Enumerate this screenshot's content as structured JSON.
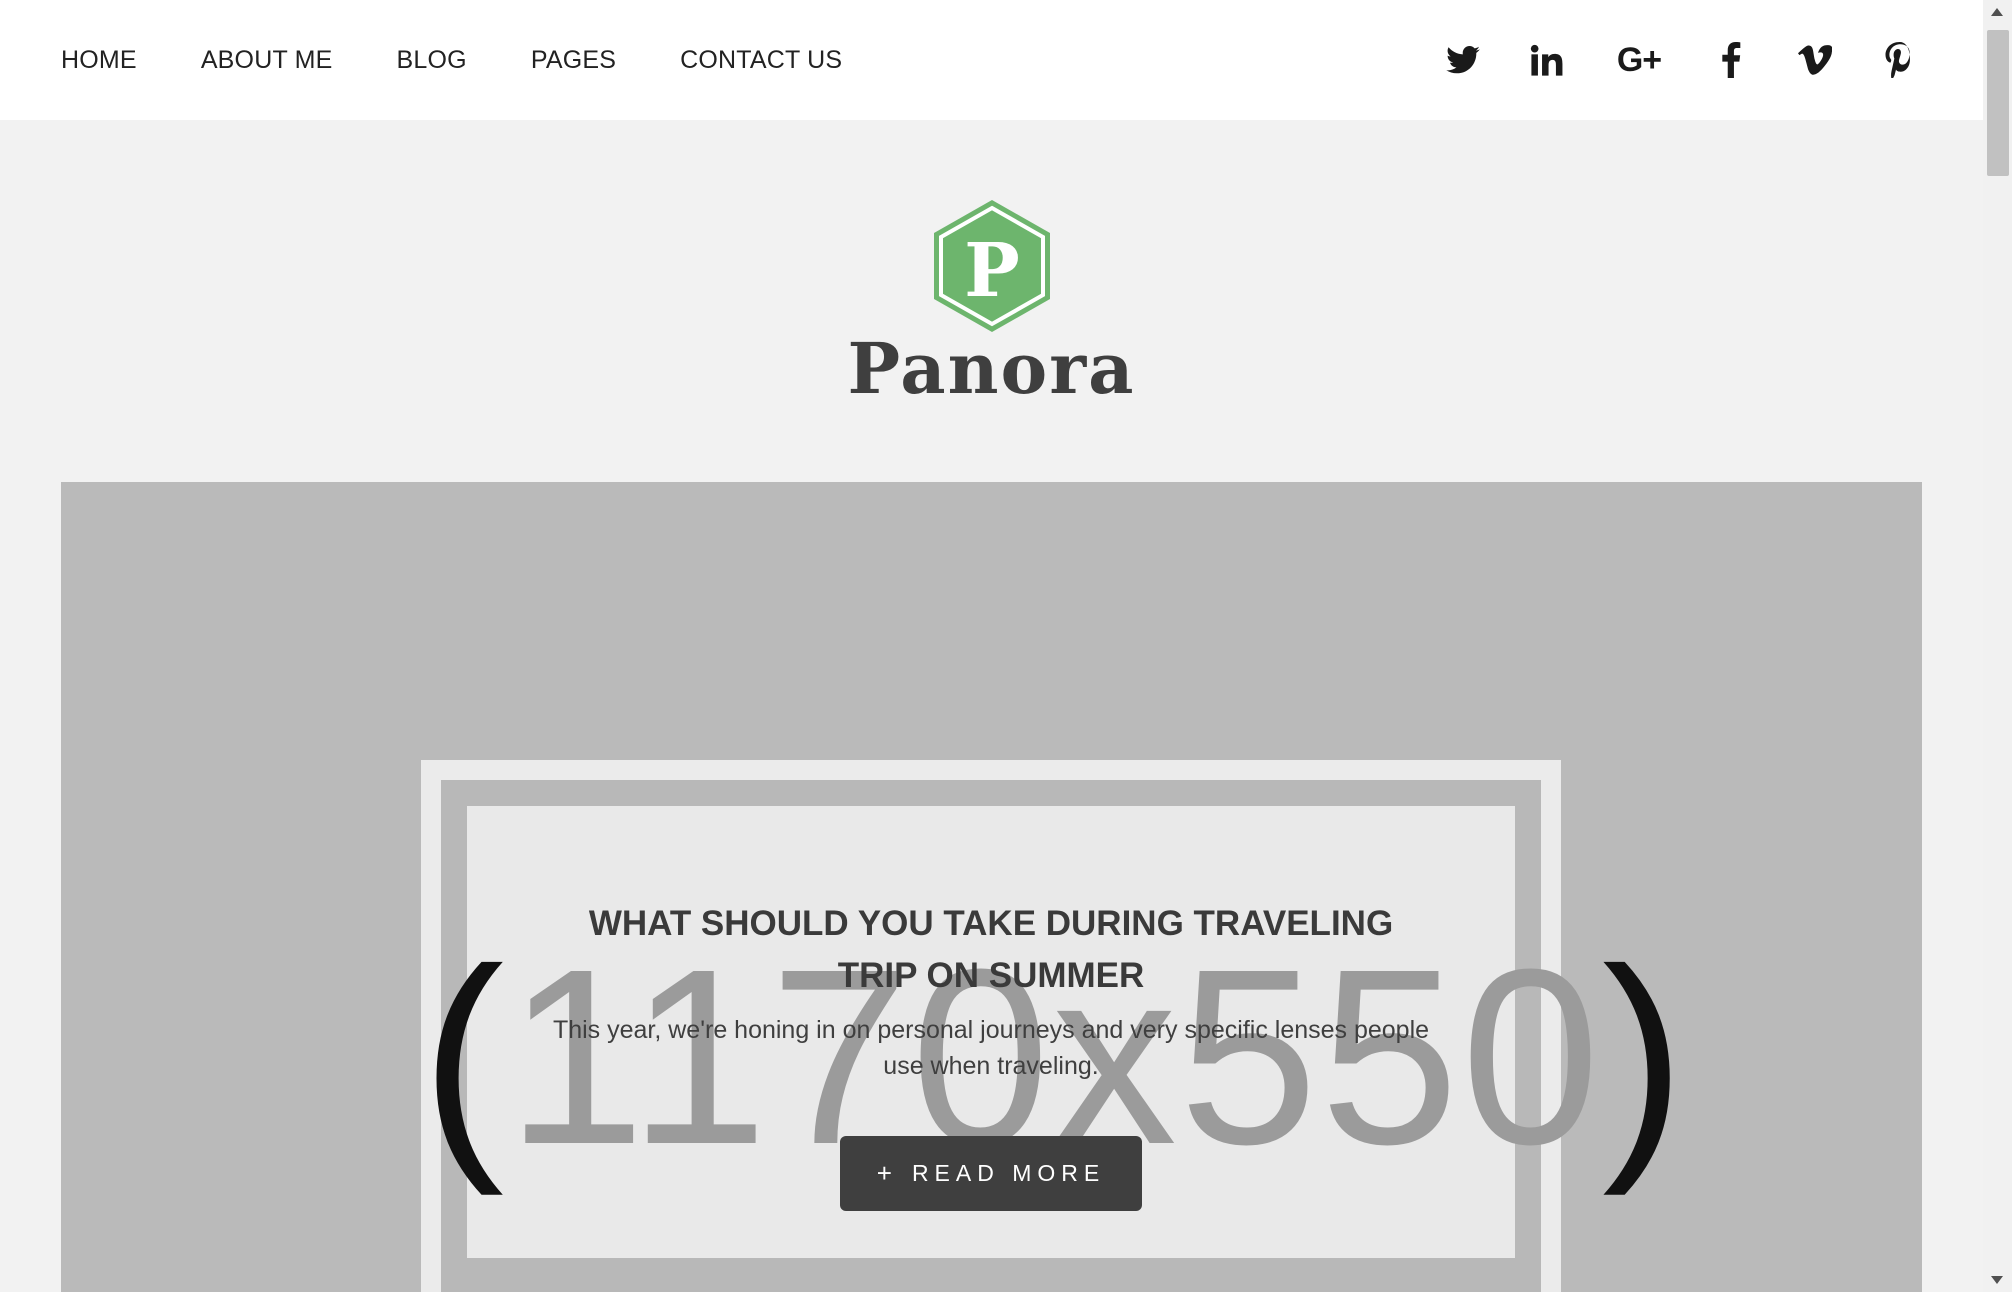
{
  "nav": {
    "items": [
      {
        "label": "HOME"
      },
      {
        "label": "ABOUT ME"
      },
      {
        "label": "BLOG"
      },
      {
        "label": "PAGES"
      },
      {
        "label": "CONTACT US"
      }
    ]
  },
  "social": {
    "icons": [
      "twitter-icon",
      "linkedin-icon",
      "google-plus-icon",
      "facebook-icon",
      "vimeo-icon",
      "pinterest-icon"
    ],
    "linkedin_text": "in",
    "gplus_text": "G+"
  },
  "logo": {
    "mark_letter": "P",
    "name": "Panora",
    "mark_color": "#6db56d"
  },
  "hero": {
    "placeholder": {
      "open": "(",
      "text": "1170x550",
      "close": ")"
    },
    "title": "WHAT SHOULD YOU TAKE DURING TRAVELING TRIP ON SUMMER",
    "description": "This year, we're honing in on personal journeys and very specific lenses people use when traveling.",
    "button": {
      "icon": "+",
      "label": "READ MORE"
    }
  },
  "colors": {
    "page_bg": "#f2f2f2",
    "hero_bg": "#bababa",
    "button_bg": "#3f3f3f",
    "text_dark": "#3a3a3a"
  }
}
